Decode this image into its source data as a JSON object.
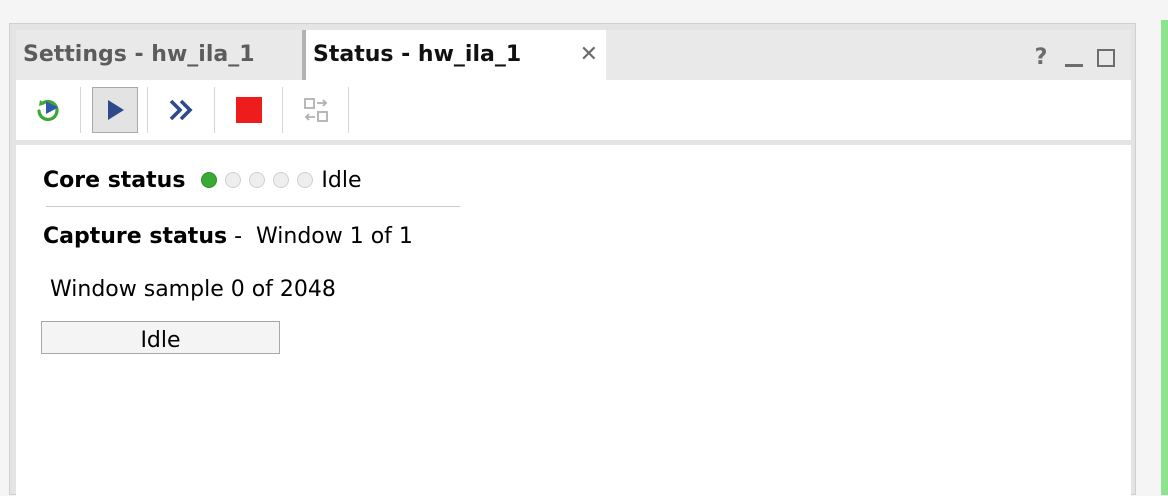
{
  "tabs": [
    {
      "label": "Settings - hw_ila_1",
      "active": false
    },
    {
      "label": "Status - hw_ila_1",
      "active": true
    }
  ],
  "tab_close_icon": "close-icon",
  "window_controls": {
    "help_label": "?",
    "icons": [
      "help-icon",
      "minimize-icon",
      "maximize-icon"
    ]
  },
  "toolbar": {
    "buttons": [
      {
        "name": "refresh-button",
        "icon": "refresh-icon"
      },
      {
        "name": "run-trigger-button",
        "icon": "play-icon",
        "active": true
      },
      {
        "name": "run-immediate-button",
        "icon": "double-chevron-right-icon"
      },
      {
        "name": "stop-trigger-button",
        "icon": "stop-icon"
      },
      {
        "name": "toggle-auto-rearm-button",
        "icon": "swap-icon",
        "disabled": true
      }
    ],
    "colors": {
      "refresh_green": "#3aa935",
      "refresh_blue": "#2f5aa8",
      "play_navy": "#2d4b8a",
      "stop_red": "#ee1c1c",
      "disabled_gray": "#b0b0b0"
    }
  },
  "core_status": {
    "label": "Core status",
    "value": "Idle",
    "indicator_count": 5,
    "active_index": 0,
    "active_color": "#3aa935"
  },
  "capture_status": {
    "label": "Capture status",
    "separator": " -  ",
    "value": "Window 1 of 1"
  },
  "window_sample": {
    "text": "Window sample 0 of 2048"
  },
  "progress": {
    "label": "Idle",
    "fraction": 0
  }
}
